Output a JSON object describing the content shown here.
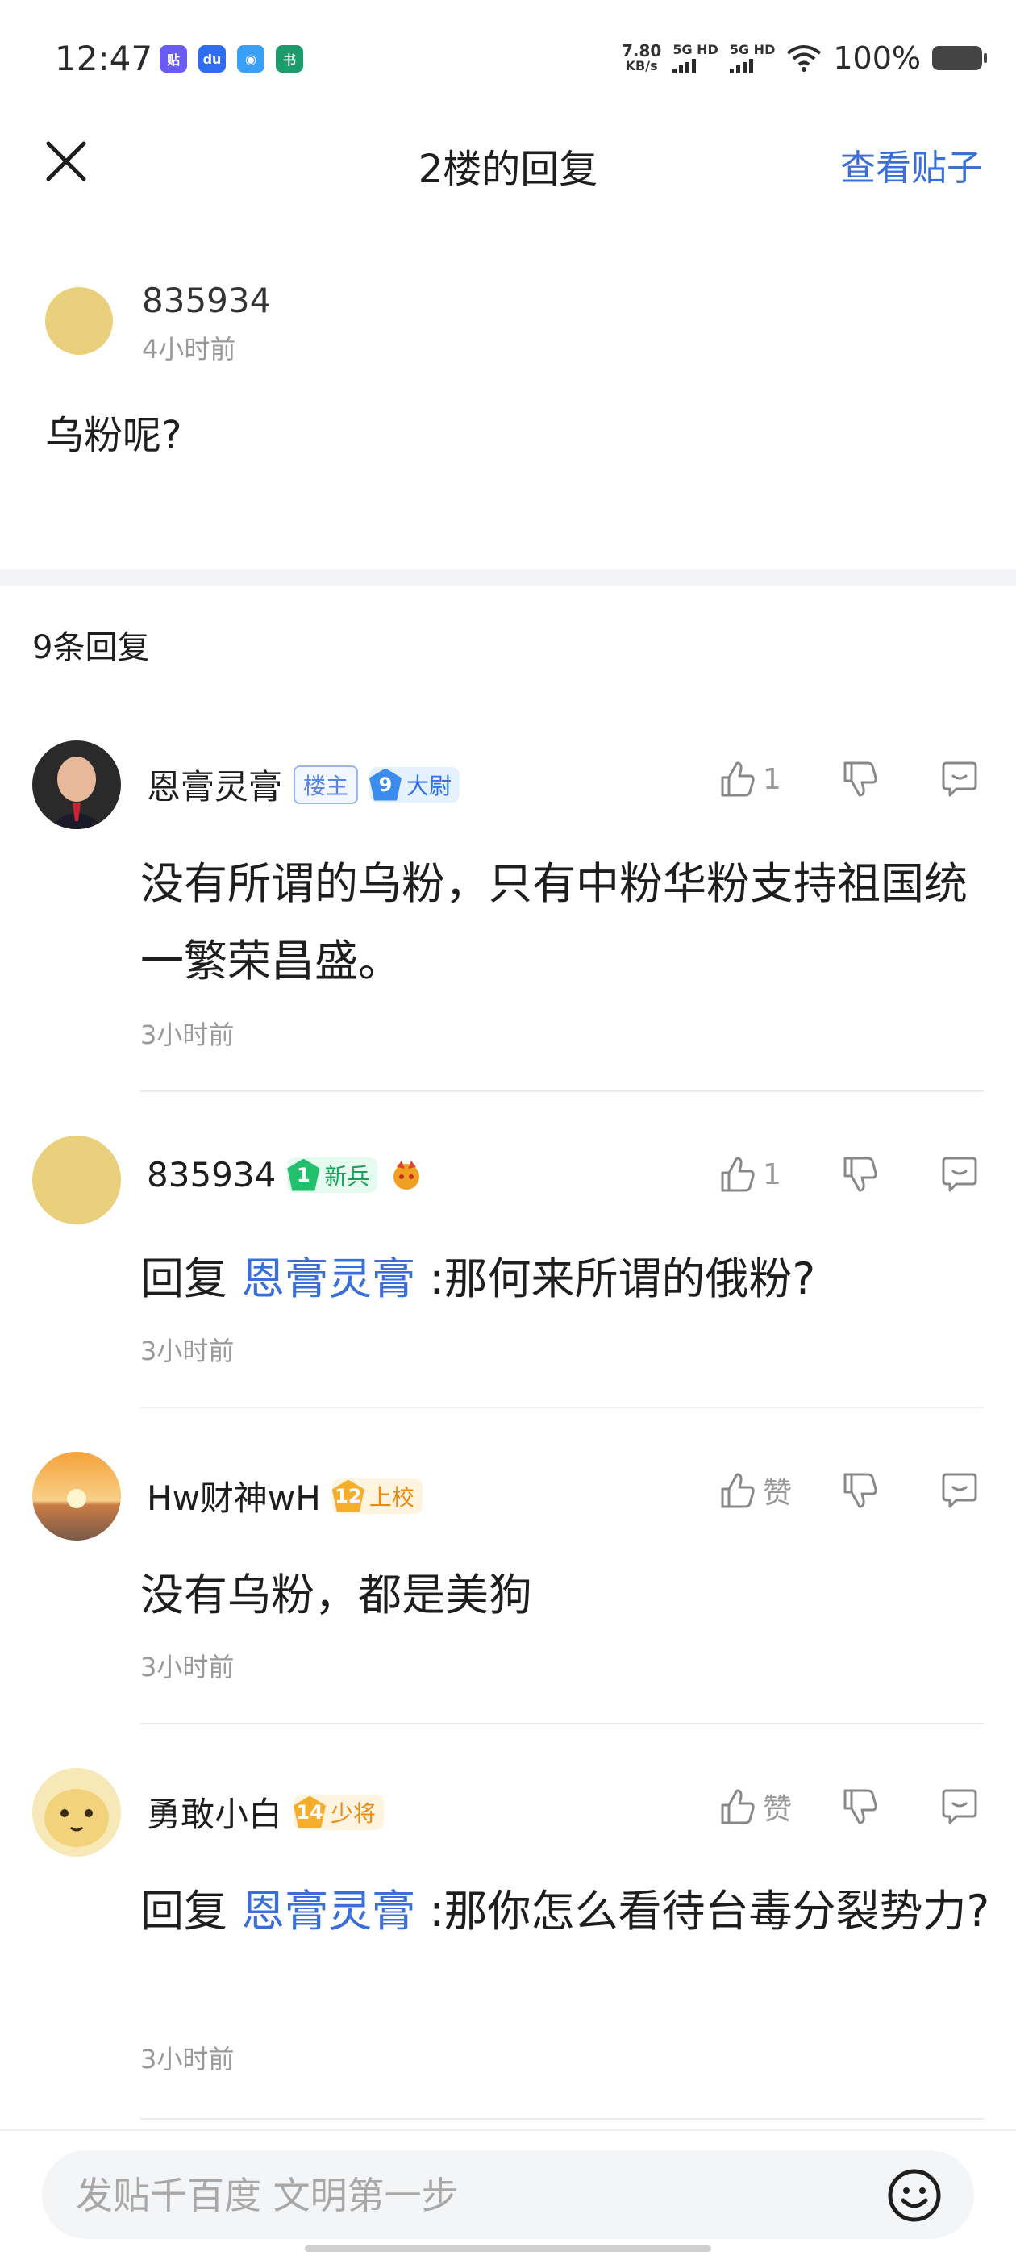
{
  "status_bar": {
    "time": "12:47",
    "net_speed_value": "7.80",
    "net_speed_unit": "KB/s",
    "sim1": "5G HD",
    "sim2": "5G HD",
    "battery": "100%",
    "app_icons": [
      "tieba-icon",
      "baidu-icon",
      "robot-app-icon",
      "app-icon"
    ]
  },
  "nav": {
    "title": "2楼的回复",
    "view_post": "查看贴子"
  },
  "original_post": {
    "username": "835934",
    "time": "4小时前",
    "text": "乌粉呢?"
  },
  "reply_count": "9条回复",
  "replies": [
    {
      "username": "恩膏灵膏",
      "host_badge": "楼主",
      "level": "9",
      "level_title": "大尉",
      "likes": "1",
      "content": "没有所谓的乌粉，只有中粉华粉支持祖国统一繁荣昌盛。",
      "time": "3小时前"
    },
    {
      "username": "835934",
      "level": "1",
      "level_title": "新兵",
      "likes": "1",
      "reply_prefix": "回复",
      "reply_to": "恩膏灵膏",
      "content": ":那何来所谓的俄粉?",
      "time": "3小时前"
    },
    {
      "username": "Hw财神wH",
      "level": "12",
      "level_title": "上校",
      "likes": "赞",
      "content": "没有乌粉，都是美狗",
      "time": "3小时前"
    },
    {
      "username": "勇敢小白",
      "level": "14",
      "level_title": "少将",
      "likes": "赞",
      "reply_prefix": "回复",
      "reply_to": "恩膏灵膏",
      "content": ":那你怎么看待台毒分裂势力?",
      "time": "3小时前"
    }
  ],
  "input": {
    "placeholder": "发贴千百度 文明第一步"
  },
  "colors": {
    "accent": "#3a6fd8",
    "muted_text": "#999999",
    "divider": "#f2f4f7"
  }
}
